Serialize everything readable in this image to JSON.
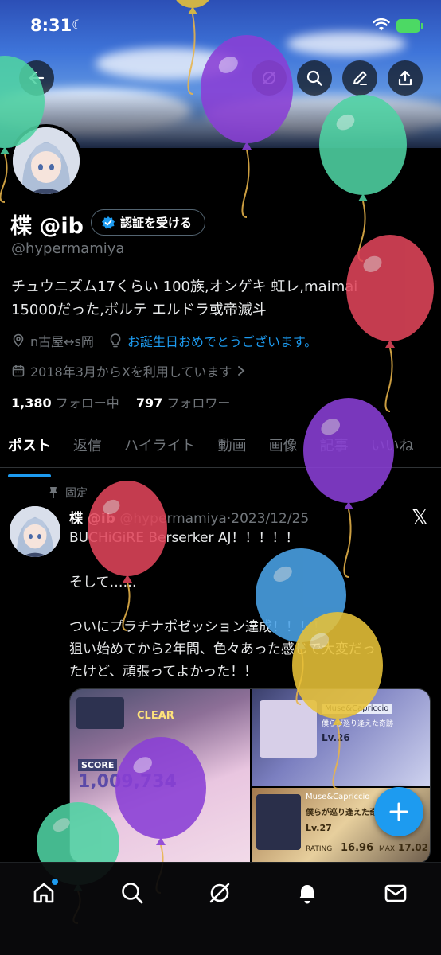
{
  "status_bar": {
    "time": "8:31"
  },
  "profile": {
    "name": "楪 @ib",
    "verify_label": "認証を受ける",
    "handle": "@hypermamiya",
    "bio_line1": "チュウニズム17くらい 100族,オンゲキ 虹レ,maimai",
    "bio_line2": "15000だった,ボルテ エルドラ或帝滅斗",
    "location": "n古屋↔s岡",
    "birthday_link": "お誕生日おめでとうございます。",
    "joined": "2018年3月からXを利用しています",
    "following_count": "1,380",
    "following_label": "フォロー中",
    "followers_count": "797",
    "followers_label": "フォロワー"
  },
  "tabs": [
    "ポスト",
    "返信",
    "ハイライト",
    "動画",
    "画像",
    "記事",
    "いいね"
  ],
  "tweet": {
    "pinned_label": "固定",
    "author_name": "楪 @ib",
    "author_handle": "@hypermamiya",
    "separator": "·",
    "date": "2023/12/25",
    "line1": "BUCHiGiRE Berserker AJ！！！！！",
    "line2": "そして……",
    "line3": "ついにプラチナポゼッション達成！！！！",
    "line4": "狙い始めてから2年間、色々あった感じで大変だっ",
    "line5": "たけど、頑張ってよかった！！",
    "media_caption_a": "CLEAR",
    "media_caption_b": "SCORE",
    "media_caption_c": "Muse&Capriccio",
    "media_caption_d": "僕らが巡り逢えた奇跡",
    "media_level_a": "Lv.26",
    "media_level_b": "Lv.27",
    "media_score": "1,009,734",
    "media_rating_label": "RATING",
    "media_rating": "16.96",
    "media_max_label": "MAX",
    "media_max": "17.02"
  },
  "icons": {
    "back": "arrow-left-icon",
    "grok": "grok-icon",
    "search": "search-icon",
    "edit": "pencil-icon",
    "share": "share-icon",
    "verify": "verified-badge-icon",
    "location": "location-pin-icon",
    "bulb": "lightbulb-icon",
    "calendar": "calendar-icon",
    "pin": "pin-icon",
    "x": "x-logo-icon",
    "compose": "plus-icon",
    "nav_home": "home-icon",
    "nav_search": "search-icon",
    "nav_grok": "grok-icon",
    "nav_notifications": "bell-icon",
    "nav_messages": "envelope-icon"
  },
  "colors": {
    "background": "#000000",
    "accent": "#1d9bf0",
    "muted": "#71767b",
    "balloon_purple": "#8a3fd6",
    "balloon_green": "#4fd3a3",
    "balloon_red": "#e0455a",
    "balloon_blue": "#4aa3e8",
    "balloon_yellow": "#e8c238"
  }
}
